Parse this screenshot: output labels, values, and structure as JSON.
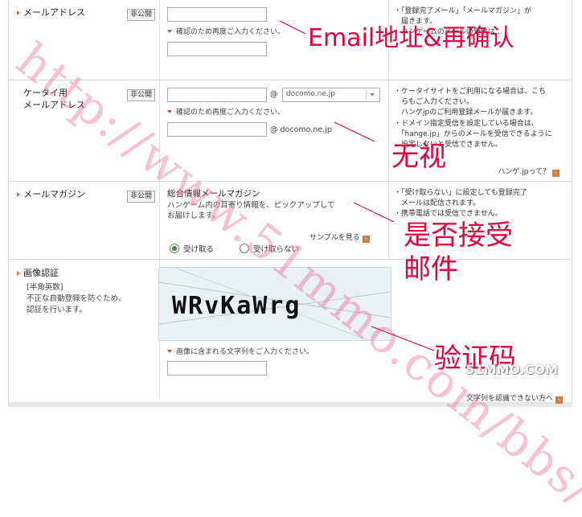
{
  "rows": {
    "email": {
      "label": "メールアドレス",
      "badge": "非公開",
      "confirm_hint": "確認のため再度ご入力ください。",
      "notes": [
        "・「登録完了メール」「メールマガジン」が",
        "　届きます。",
        "　ハンゲームのメールの受信は…"
      ]
    },
    "mobile": {
      "label_line1": "ケータイ用",
      "label_line2": "メールアドレス",
      "badge": "非公開",
      "at": "@",
      "domain_select": "docomo.ne.jp",
      "confirm_hint": "確認のため再度ご入力ください。",
      "confirm_domain": "@ docomo.ne.jp",
      "notes": [
        "・ケータイサイトをご利用になる場合は、こち",
        "　らもご入力ください。",
        "　ハンゲjpのご利用登録メールが届きます。",
        "・ドメイン指定受信を設定している場合は、",
        "　「hange.jp」からのメールを受信できるように",
        "　設定しないと受信できません。"
      ],
      "link": "ハンゲ.jpって？"
    },
    "magazine": {
      "label": "メールマガジン",
      "badge": "非公開",
      "title": "総合情報メールマガジン",
      "desc_line1": "ハンゲーム内の耳寄り情報を、ピックアップして",
      "desc_line2": "お届けします。",
      "sample_link": "サンプルを見る",
      "opt_receive": "受け取る",
      "opt_decline": "受け取らない",
      "notes": [
        "・「受け取らない」に設定しても登録完了",
        "　メールは配信されます。",
        "・携帯電話では受信できません。"
      ]
    },
    "captcha": {
      "label": "画像認証",
      "sub_tag": "[半角英数]",
      "desc_line1": "不正な自動登録を防ぐため、",
      "desc_line2": "認証を行います。",
      "captcha_text": "WRvKaWrg",
      "input_hint": "画像に含まれる文字列をご入力ください。",
      "cant_read_link": "文字列を認識できない方へ"
    }
  },
  "annotations": {
    "email": "Email地址&再确认",
    "mobile": "无视",
    "magazine_line1": "是否接受",
    "magazine_line2": "邮件",
    "captcha": "验证码"
  },
  "watermark": "http://www.51mmo.com/bbs/",
  "logo": "51MMO.COM",
  "colors": {
    "annotation": "#e6003a",
    "accent": "#e0712a",
    "watermark": "#eb7896"
  }
}
